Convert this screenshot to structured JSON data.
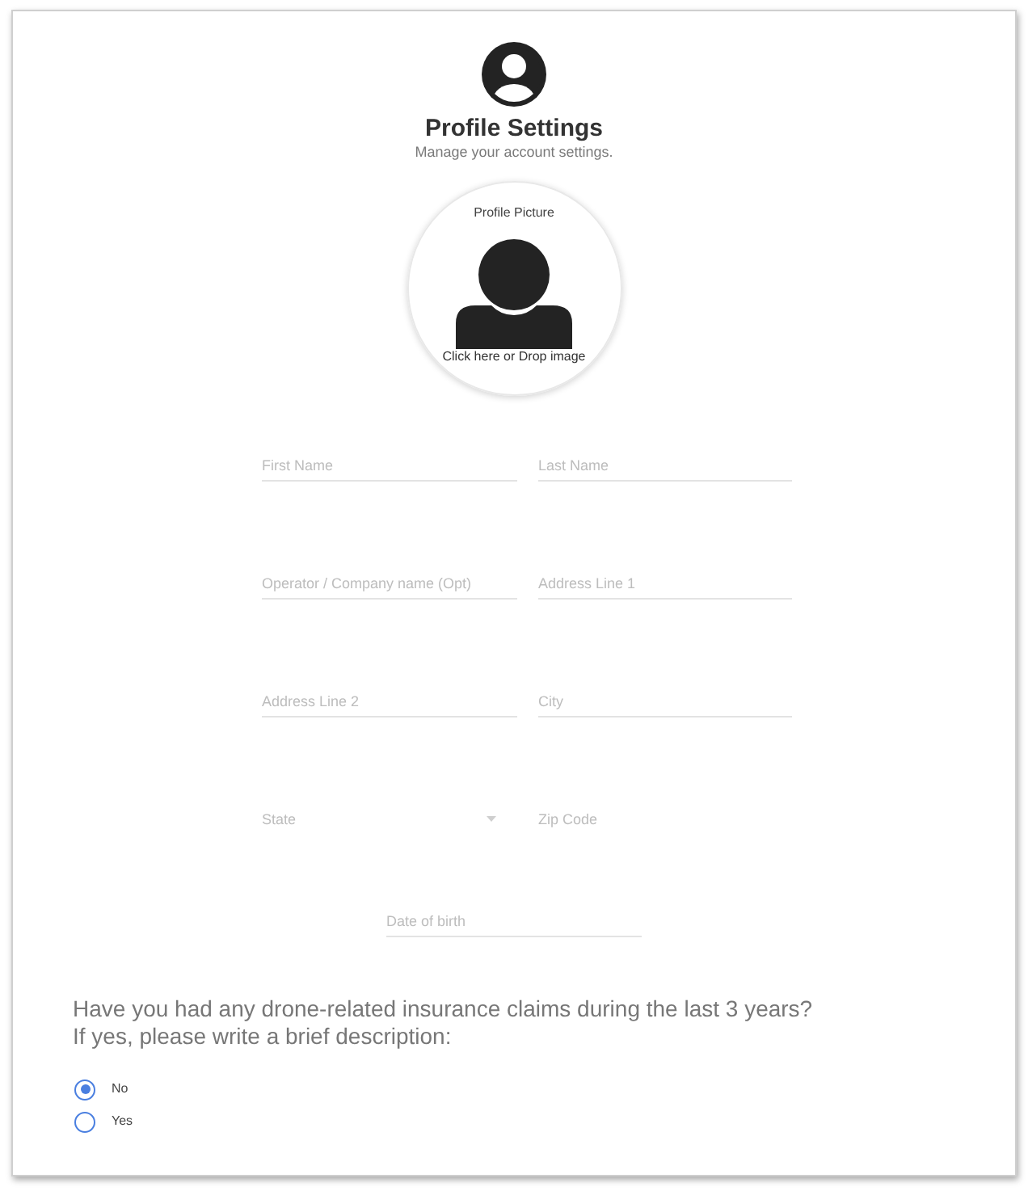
{
  "header": {
    "title": "Profile Settings",
    "subtitle": "Manage your account settings."
  },
  "profile_picture": {
    "label": "Profile Picture",
    "hint": "Click here or Drop image"
  },
  "field_rows": [
    {
      "fields": [
        {
          "kind": "text",
          "placeholder": "First Name",
          "underlined": true
        },
        {
          "kind": "text",
          "placeholder": "Last Name",
          "underlined": true
        }
      ]
    },
    {
      "fields": [
        {
          "kind": "text",
          "placeholder": "Operator / Company name (Opt)",
          "underlined": true
        },
        {
          "kind": "text",
          "placeholder": "Address Line 1",
          "underlined": true
        }
      ]
    },
    {
      "fields": [
        {
          "kind": "text",
          "placeholder": "Address Line 2",
          "underlined": true
        },
        {
          "kind": "text",
          "placeholder": "City",
          "underlined": true
        }
      ]
    },
    {
      "fields": [
        {
          "kind": "select",
          "placeholder": "State",
          "underlined": false
        },
        {
          "kind": "text",
          "placeholder": "Zip Code",
          "underlined": false
        }
      ]
    }
  ],
  "date_of_birth": {
    "kind": "text",
    "placeholder": "Date of birth",
    "underlined": true
  },
  "insurance_question": {
    "question": "Have you had any drone-related insurance claims during the last 3 years?\nIf yes, please write a brief description:",
    "options": [
      {
        "label": "No",
        "selected": true
      },
      {
        "label": "Yes",
        "selected": false
      }
    ]
  }
}
